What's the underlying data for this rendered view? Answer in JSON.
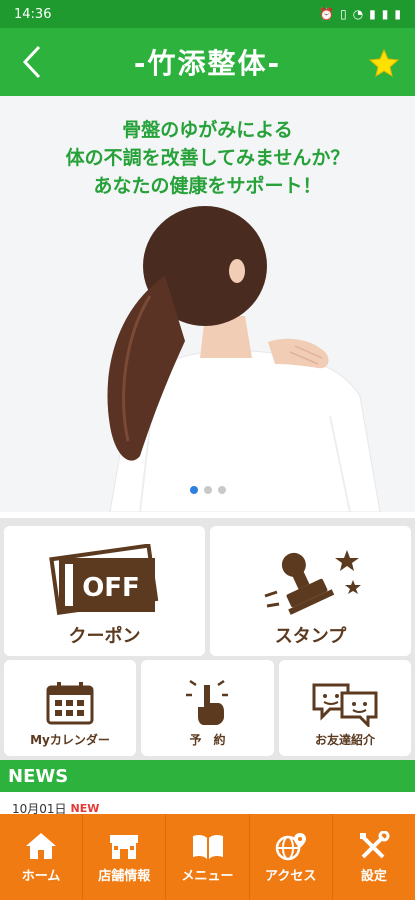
{
  "status_bar": {
    "time": "14:36"
  },
  "header": {
    "title": "-竹添整体-"
  },
  "hero": {
    "lines": [
      "骨盤のゆがみによる",
      "体の不調を改善してみませんか？",
      "あなたの健康をサポート！"
    ]
  },
  "menu": {
    "coupon": {
      "label": "クーポン",
      "ticket_text": "OFF"
    },
    "stamp": {
      "label": "スタンプ"
    },
    "calendar": {
      "label": "Myカレンダー"
    },
    "reserve": {
      "label": "予　約"
    },
    "friend": {
      "label": "お友達紹介"
    }
  },
  "news": {
    "title": "NEWS",
    "items": [
      {
        "date": "10月01日",
        "badge": "NEW"
      }
    ]
  },
  "bottom_nav": {
    "home": "ホーム",
    "shop": "店舗情報",
    "menu": "メニュー",
    "access": "アクセス",
    "settings": "設定"
  },
  "colors": {
    "green": "#2db33d",
    "orange": "#f07b12",
    "brown": "#5b3a1f"
  }
}
